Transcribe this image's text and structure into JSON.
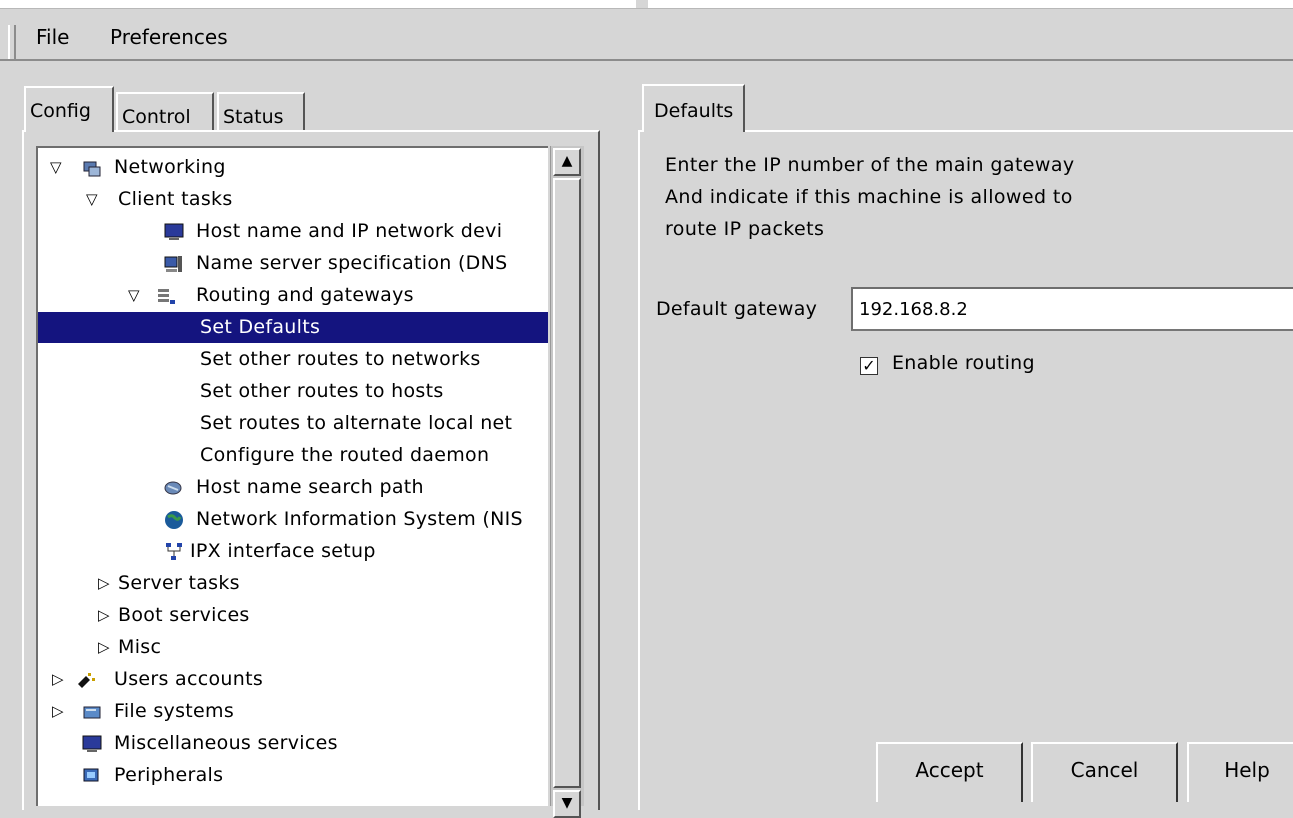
{
  "menubar": {
    "file": "File",
    "preferences": "Preferences"
  },
  "left_tabs": {
    "config": "Config",
    "control": "Control",
    "status": "Status"
  },
  "tree": {
    "items": [
      {
        "label": "Networking",
        "expander": "▽",
        "icon": "networking-icon"
      },
      {
        "label": "Client tasks",
        "expander": "▽"
      },
      {
        "label": "Host name and IP network devi",
        "icon": "monitor-icon"
      },
      {
        "label": "Name server specification (DNS",
        "icon": "server-icon"
      },
      {
        "label": "Routing and gateways",
        "expander": "▽",
        "icon": "router-icon"
      },
      {
        "label": "Set Defaults",
        "selected": true
      },
      {
        "label": "Set other routes to networks"
      },
      {
        "label": "Set other routes to hosts"
      },
      {
        "label": "Set routes to alternate local net"
      },
      {
        "label": "Configure the routed daemon"
      },
      {
        "label": "Host name search path",
        "icon": "magnifier-icon"
      },
      {
        "label": "Network Information System (NIS",
        "icon": "globe-icon"
      },
      {
        "label": "IPX interface setup",
        "icon": "ipx-network-icon"
      },
      {
        "label": "Server tasks",
        "expander": "▷"
      },
      {
        "label": "Boot services",
        "expander": "▷"
      },
      {
        "label": "Misc",
        "expander": "▷"
      },
      {
        "label": "Users accounts",
        "expander": "▷",
        "icon": "users-icon"
      },
      {
        "label": "File systems",
        "expander": "▷",
        "icon": "disk-icon"
      },
      {
        "label": "Miscellaneous services",
        "icon": "monitor-icon"
      },
      {
        "label": "Peripherals",
        "icon": "peripherals-icon"
      }
    ]
  },
  "right": {
    "tab": "Defaults",
    "description": [
      "Enter the IP number of the main gateway",
      "And indicate if this machine is allowed to",
      "route IP packets"
    ],
    "gateway_label": "Default gateway",
    "gateway_value": "192.168.8.2",
    "routing_label": "Enable routing",
    "routing_checked": "☑",
    "buttons": {
      "accept": "Accept",
      "cancel": "Cancel",
      "help": "Help"
    }
  },
  "colors": {
    "background": "#d6d6d6",
    "selection": "#14147f",
    "field": "#ffffff"
  }
}
